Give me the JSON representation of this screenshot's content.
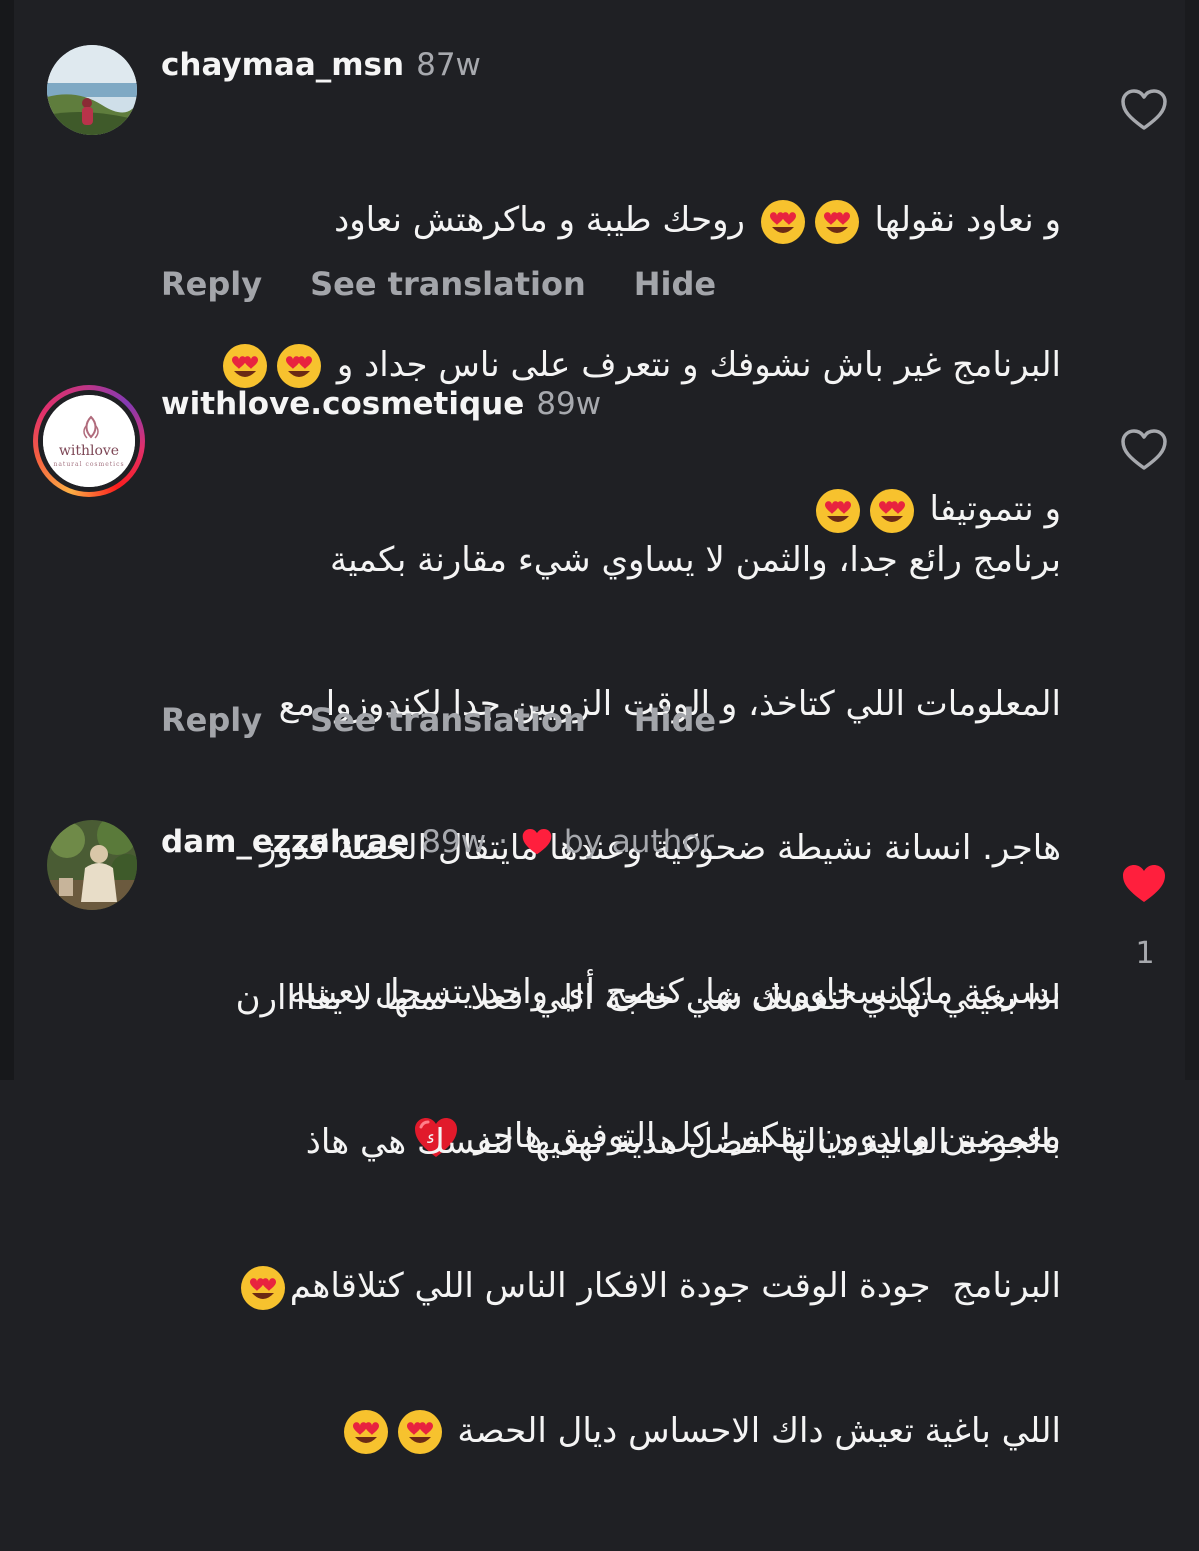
{
  "comments": [
    {
      "username": "chaymaa_msn",
      "time": "87w",
      "lines": [
        "و نعاود نقولها 😍😍 روحك طيبة و ماكرهتش نعاود",
        "البرنامج غير باش نشوفك و نتعرف على ناس جداد و 😍😍",
        "و نتموتيفا 😍😍"
      ],
      "actions": [
        "Reply",
        "See translation",
        "Hide"
      ],
      "liked": false,
      "avatar_icon": "beach-photo-avatar"
    },
    {
      "username": "withlove.cosmetique",
      "time": "89w",
      "lines": [
        "برنامج رائع جدا، والثمن لا يساوي شيء مقارنة بكمية",
        "المعلومات اللي كتاخذ، و الوقت الزويين جدا لكندوزوا مع",
        "هاجر. انسانة نشيطة ضحوكية وعندها مايتقال الحصة كدوز",
        "بسرعة ماكانسخاووش بها. كنصح أي واحد يتسجل بعينيه",
        "مغمضين و بدوون تفكير! كل التوفيق هاجر ❤️"
      ],
      "actions": [
        "Reply",
        "See translation",
        "Hide"
      ],
      "liked": false,
      "avatar_logo_text": "withlove",
      "avatar_logo_sub": "natural cosmetics"
    },
    {
      "username": "dam_ezzahrae",
      "time": "89w",
      "separator": "·",
      "author_badge": "by author",
      "lines": [
        "اذا بغيتي تهدي لنفسك شي حاجة اللي فعلا  ثمنها لا يقاااارن",
        "بالجودة العالية ديالها افضل هدية تهديها لنفسك هي هاذ",
        "البرنامج  جودة الوقت جودة الافكار الناس اللي كتلاقاهم 😍",
        "اللي باغية تعيش داك الاحساس ديال الحصة 😍😍"
      ],
      "liked": true,
      "like_count": "1",
      "avatar_icon": "garden-photo-avatar"
    }
  ],
  "colors": {
    "background": "#1f2024",
    "secondary_text": "#a7a9ae",
    "like_red": "#ff1f3d"
  }
}
